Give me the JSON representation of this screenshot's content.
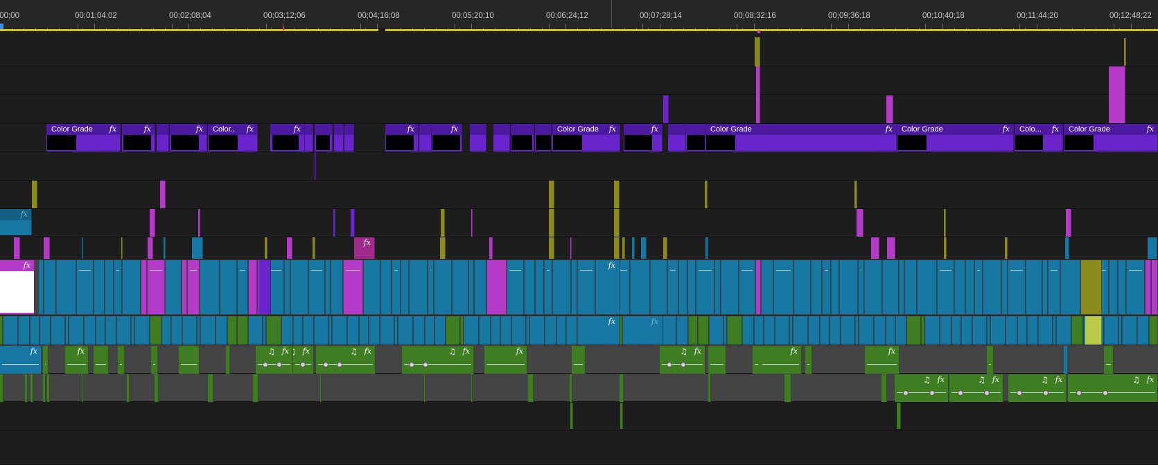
{
  "ruler": {
    "timecodes": [
      "00;00",
      "00;01;04;02",
      "00;02;08;04",
      "00;03;12;06",
      "00;04;16;08",
      "00;05;20;10",
      "00;06;24;12",
      "00;07;28;14",
      "00;08;32;16",
      "00;09;36;18",
      "00;10;40;18",
      "00;11;44;20",
      "00;12;48;22"
    ],
    "display_first": ";00;00"
  },
  "effect_label": "Color Grade",
  "effect_label_short1": "Color..",
  "effect_label_short2": "Colo...",
  "fx_symbol": "fx",
  "note_symbol": "♫",
  "colors": {
    "video_adjustment": "#6a24cc",
    "video_clip": "#1677a3",
    "audio_clip": "#3f7d23",
    "magenta_clip": "#b43bc8",
    "olive_clip": "#8b8a1c",
    "playbar": "#d2c218",
    "background": "#1e1e1e"
  }
}
